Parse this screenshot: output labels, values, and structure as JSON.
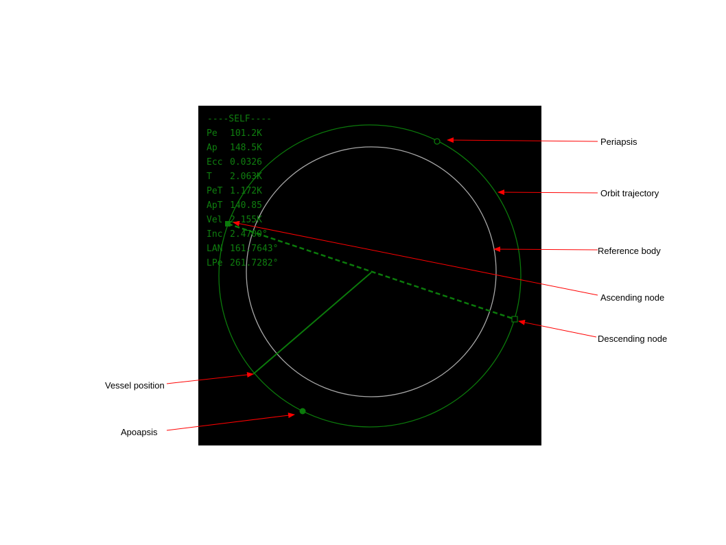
{
  "mfd": {
    "header": "----SELF----",
    "rows": [
      {
        "key": "Pe",
        "value": "101.2K"
      },
      {
        "key": "Ap",
        "value": "148.5K"
      },
      {
        "key": "Ecc",
        "value": "0.0326"
      },
      {
        "key": "T",
        "value": "2.063K"
      },
      {
        "key": "PeT",
        "value": "1.172K"
      },
      {
        "key": "ApT",
        "value": "140.85"
      },
      {
        "key": "Vel",
        "value": "2.155K"
      },
      {
        "key": "Inc",
        "value": "2.4700°"
      },
      {
        "key": "LAN",
        "value": "161.7643°"
      },
      {
        "key": "LPe",
        "value": "261.7282°"
      }
    ]
  },
  "callouts": {
    "periapsis": "Periapsis",
    "orbit_trajectory": "Orbit trajectory",
    "reference_body": "Reference body",
    "ascending_node": "Ascending node",
    "descending_node": "Descending node",
    "vessel_position": "Vessel position",
    "apoapsis": "Apoapsis"
  },
  "colors": {
    "screen": "#000000",
    "orbit": "#0b7a0b",
    "text": "#0f7f0f",
    "body": "#a8a8a8",
    "arrow": "#ff0000",
    "label": "#000000"
  }
}
